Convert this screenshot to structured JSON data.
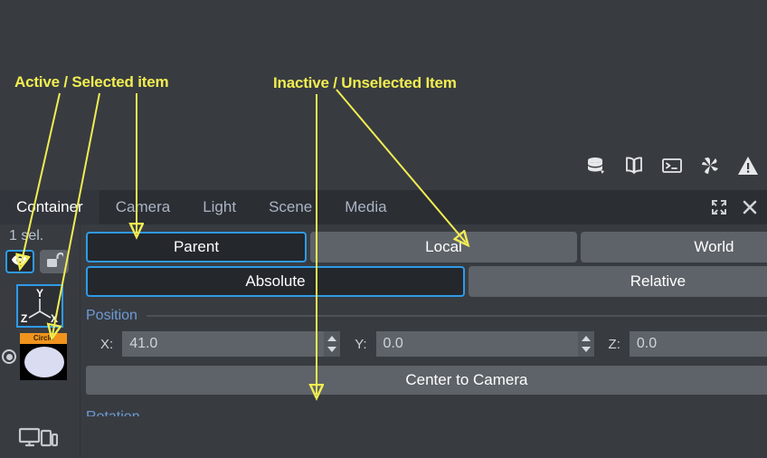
{
  "annotations": [
    {
      "id": "active",
      "text": "Active / Selected item",
      "color": "#f2ed51"
    },
    {
      "id": "inactive",
      "text": "Inactive / Unselected Item",
      "color": "#f2ed51"
    }
  ],
  "toolbar_icons": [
    {
      "name": "database-icon",
      "label": "Database"
    },
    {
      "name": "book-icon",
      "label": "Documentation"
    },
    {
      "name": "terminal-icon",
      "label": "Console"
    },
    {
      "name": "plugin-icon",
      "label": "Plugins"
    },
    {
      "name": "warning-icon",
      "label": "Warnings"
    }
  ],
  "tabs": [
    {
      "label": "Container",
      "active": true
    },
    {
      "label": "Camera",
      "active": false
    },
    {
      "label": "Light",
      "active": false
    },
    {
      "label": "Scene",
      "active": false
    },
    {
      "label": "Media",
      "active": false
    }
  ],
  "window_controls": {
    "expand_label": "Expand",
    "close_label": "Close"
  },
  "sidebar": {
    "selection_count": "1 sel.",
    "visibility_toggle": {
      "name": "eye-icon",
      "state": "on"
    },
    "lock_toggle": {
      "name": "unlock-icon",
      "state": "off"
    },
    "gizmo": {
      "axis_y": "Y",
      "axis_z": "Z",
      "axis_x": "X"
    },
    "item": {
      "name": "Circle",
      "caption": "Circle"
    },
    "devices_icon": "devices-icon"
  },
  "panel": {
    "space_buttons": [
      {
        "label": "Parent",
        "selected": true
      },
      {
        "label": "Local",
        "selected": false
      },
      {
        "label": "World",
        "selected": false
      }
    ],
    "mode_buttons": [
      {
        "label": "Absolute",
        "selected": true
      },
      {
        "label": "Relative",
        "selected": false
      }
    ],
    "position": {
      "title": "Position",
      "x": {
        "label": "X:",
        "value": "41.0"
      },
      "y": {
        "label": "Y:",
        "value": "0.0"
      },
      "z": {
        "label": "Z:",
        "value": "0.0"
      }
    },
    "center_to_camera_label": "Center to Camera",
    "next_section_title": "Rotation"
  },
  "colors": {
    "background": "#383c41",
    "tabbar": "#2b2e33",
    "active_tab": "#32363c",
    "button_gray": "#5e6369",
    "selected_dark": "#24272c",
    "accent_blue": "#2f9ae8",
    "section_blue": "#6f9ad6",
    "annotation_yellow": "#f2ed51",
    "thumb_orange": "#f0941e"
  }
}
